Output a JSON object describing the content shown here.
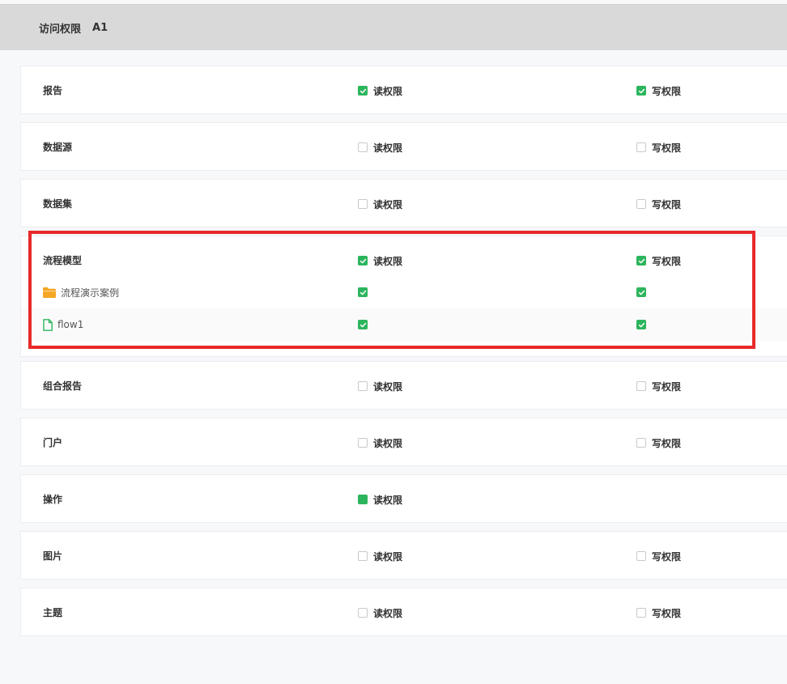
{
  "header": {
    "title": "访问权限",
    "role": "A1"
  },
  "permissions": {
    "read_label": "读权限",
    "write_label": "写权限"
  },
  "rows": [
    {
      "name": "报告",
      "read": "checked",
      "write": "checked"
    },
    {
      "name": "数据源",
      "read": "unchecked",
      "write": "unchecked"
    },
    {
      "name": "数据集",
      "read": "unchecked",
      "write": "unchecked"
    },
    {
      "name": "流程模型",
      "read": "checked",
      "write": "checked",
      "children": [
        {
          "name": "流程演示案例",
          "icon": "folder-icon",
          "read": "checked",
          "write": "checked"
        },
        {
          "name": "flow1",
          "icon": "file-icon",
          "read": "checked",
          "write": "checked"
        }
      ]
    },
    {
      "name": "组合报告",
      "read": "unchecked",
      "write": "unchecked"
    },
    {
      "name": "门户",
      "read": "unchecked",
      "write": "unchecked"
    },
    {
      "name": "操作",
      "read": "indeterminate"
    },
    {
      "name": "图片",
      "read": "unchecked",
      "write": "unchecked"
    },
    {
      "name": "主题",
      "read": "unchecked",
      "write": "unchecked"
    }
  ],
  "colors": {
    "check_green": "#2db55d",
    "highlight_red": "#e8292a",
    "folder_orange": "#f5a623",
    "file_green": "#2db55d"
  }
}
